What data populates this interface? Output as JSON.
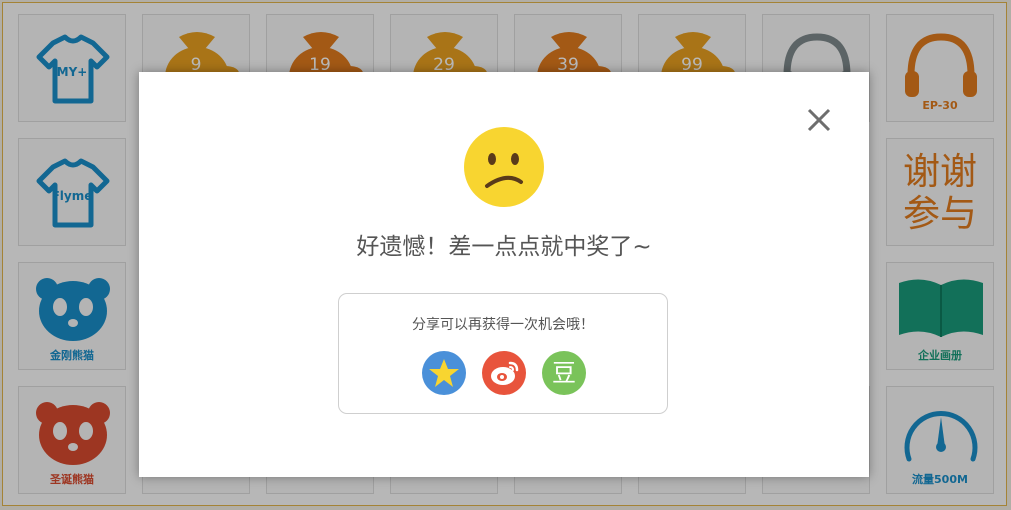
{
  "prizes": {
    "tshirt_myplus": "MY+",
    "tshirt_flyme": "Flyme",
    "bag_9": "9",
    "bag_19": "19",
    "bag_29": "29",
    "bag_39": "39",
    "bag_99": "99",
    "headphone_label": "EP-30",
    "thanks_line1": "谢谢",
    "thanks_line2": "参与",
    "panda_blue": "金刚熊猫",
    "panda_red": "圣诞熊猫",
    "book_label": "企业画册",
    "gauge_label": "流量500M"
  },
  "modal": {
    "message": "好遗憾！差一点点就中奖了~",
    "share_prompt": "分享可以再获得一次机会哦！",
    "douban_glyph": "豆"
  },
  "icons": {
    "close": "close-icon",
    "face": "confused-face-icon",
    "qzone": "star-icon",
    "weibo": "weibo-icon",
    "douban": "douban-icon"
  },
  "colors": {
    "blue_prize": "#1a8ec8",
    "orange_prize": "#e07b1e",
    "red_prize": "#d84a2f",
    "green_prize": "#1a9a7a",
    "qzone": "#4a90d9",
    "weibo": "#e8543c",
    "douban": "#7ac35a",
    "face": "#f8d530"
  }
}
